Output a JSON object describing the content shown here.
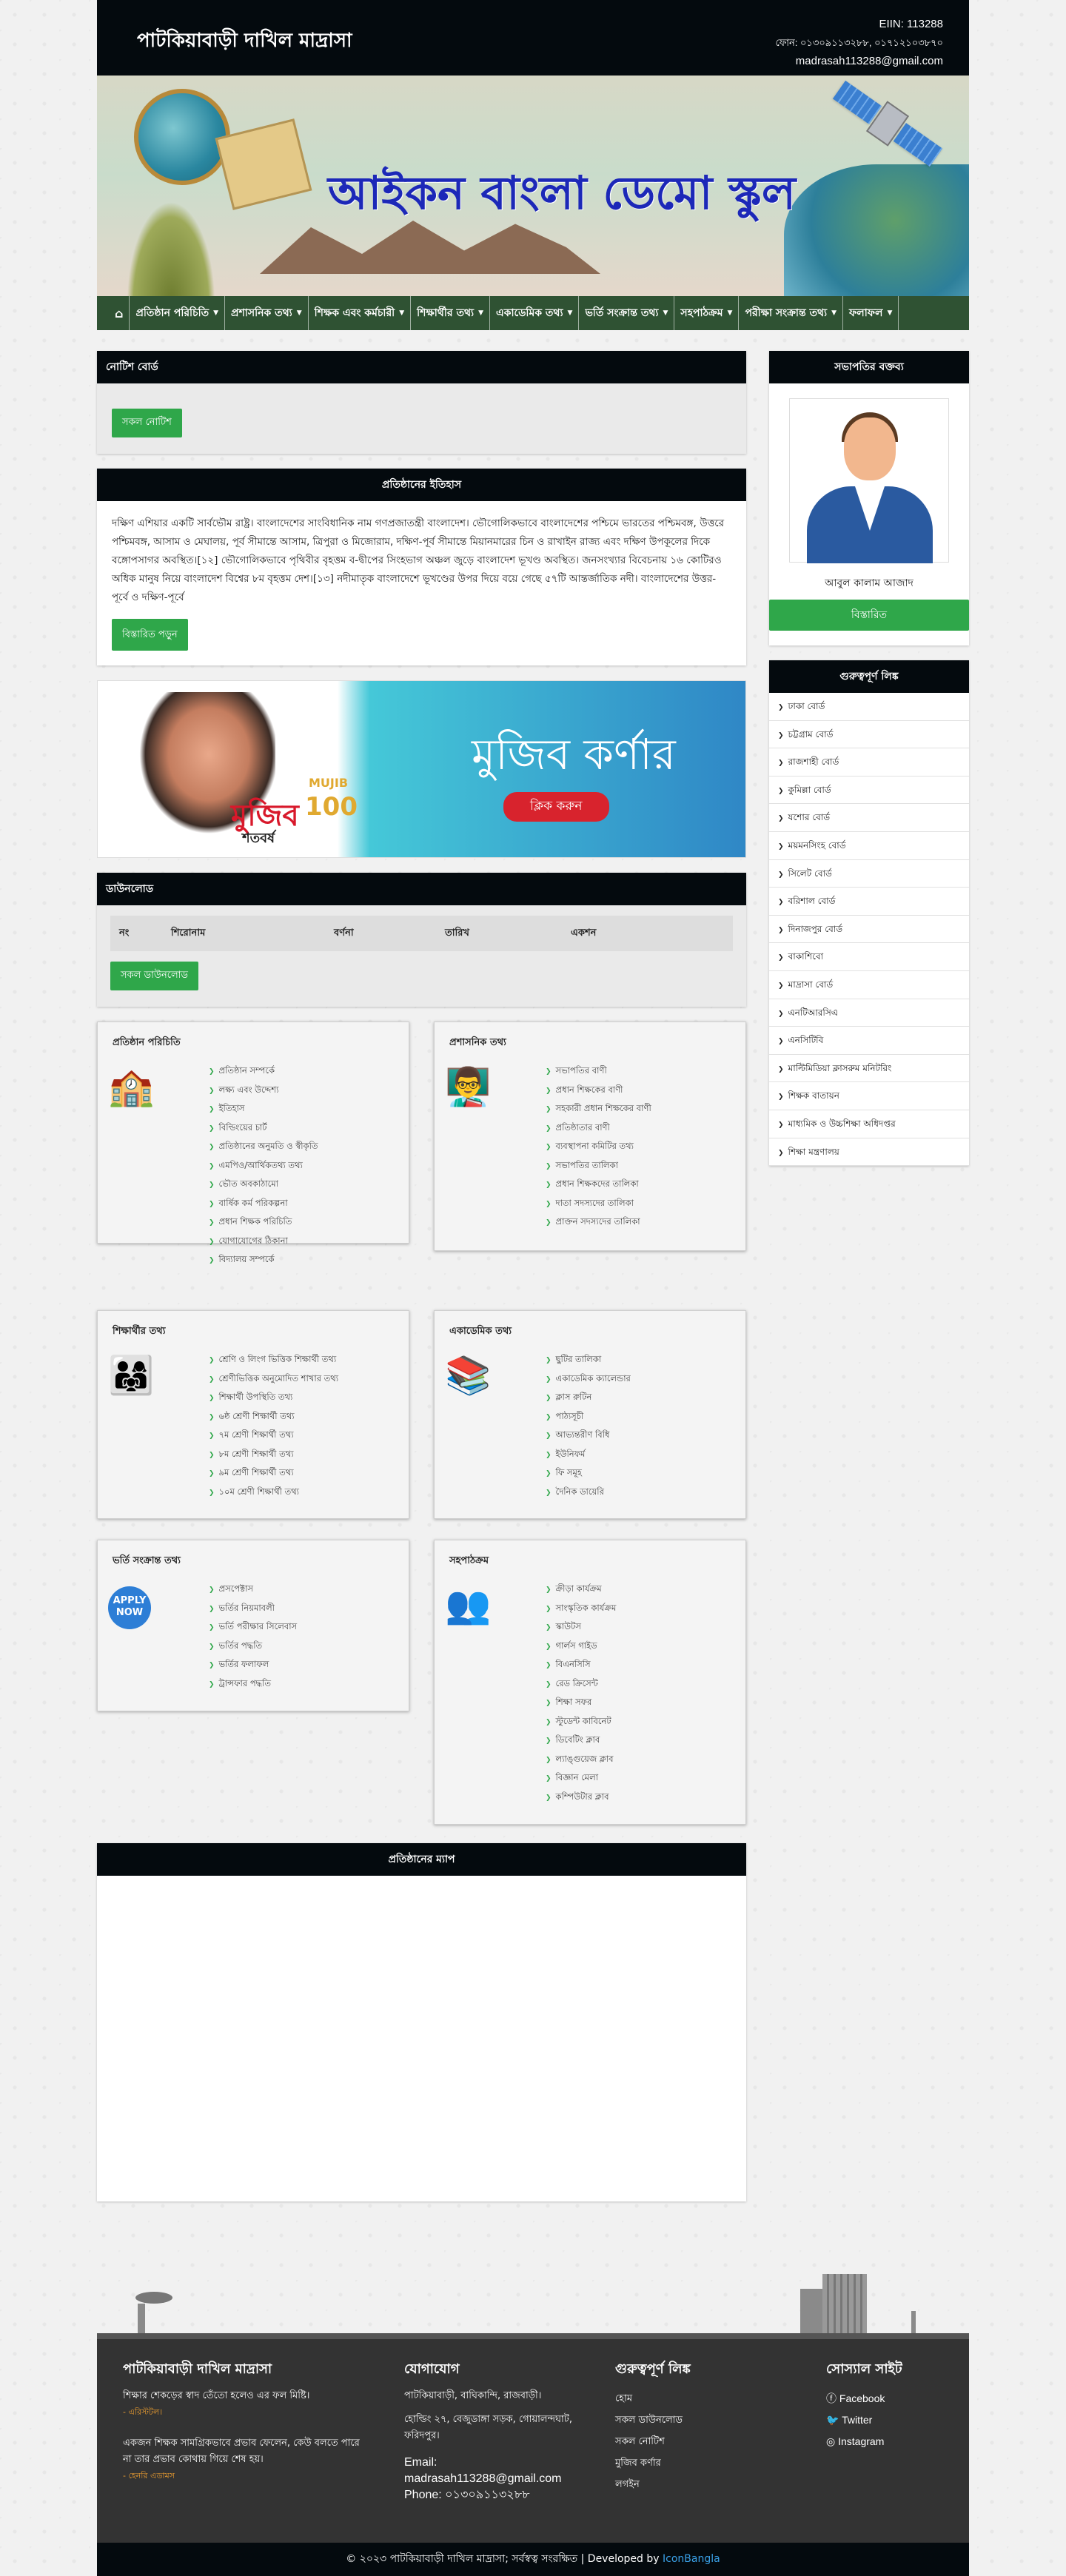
{
  "header": {
    "school_name": "পাটকিয়াবাড়ী দাখিল মাদ্রাসা",
    "eiin": "EIIN: 113288",
    "phone": "ফোন: ০১৩০৯১১৩২৮৮, ০১৭১২১০৩৮৭০",
    "email": "madrasah113288@gmail.com"
  },
  "banner": {
    "title": "আইকন বাংলা ডেমো স্কুল"
  },
  "nav": [
    {
      "label": "প্রতিষ্ঠান পরিচিতি",
      "caret": true
    },
    {
      "label": "প্রশাসনিক তথ্য",
      "caret": true
    },
    {
      "label": "শিক্ষক এবং কর্মচারী",
      "caret": true
    },
    {
      "label": "শিক্ষার্থীর তথ্য",
      "caret": true
    },
    {
      "label": "একাডেমিক তথ্য",
      "caret": true
    },
    {
      "label": "ভর্তি সংক্রান্ত তথ্য",
      "caret": true
    },
    {
      "label": "সহপাঠক্রম",
      "caret": true
    },
    {
      "label": "পরীক্ষা সংক্রান্ত তথ্য",
      "caret": true
    },
    {
      "label": "ফলাফল",
      "caret": true
    }
  ],
  "notice": {
    "heading": "নোটিশ বোর্ড",
    "all_button": "সকল নোটিশ"
  },
  "history": {
    "heading": "প্রতিষ্ঠানের ইতিহাস",
    "text": "দক্ষিণ এশিয়ার একটি সার্বভৌম রাষ্ট্র। বাংলাদেশের সাংবিধানিক নাম গণপ্রজাতন্ত্রী বাংলাদেশ। ভৌগোলিকভাবে বাংলাদেশের পশ্চিমে ভারতের পশ্চিমবঙ্গ, উত্তরে পশ্চিমবঙ্গ, আসাম ও মেঘালয়, পূর্ব সীমান্তে আসাম, ত্রিপুরা ও মিজোরাম, দক্ষিণ-পূর্ব সীমান্তে মিয়ানমারের চিন ও রাখাইন রাজ্য এবং দক্ষিণ উপকূলের দিকে বঙ্গোপসাগর অবস্থিত।[১২] ভৌগোলিকভাবে পৃথিবীর বৃহত্তম ব-দ্বীপের সিংহভাগ অঞ্চল জুড়ে বাংলাদেশ ভূখণ্ড অবস্থিত। জনসংখ্যার বিবেচনায় ১৬ কোটিরও অধিক মানুষ নিয়ে বাংলাদেশ বিশ্বের ৮ম বৃহত্তম দেশ।[১৩] নদীমাতৃক বাংলাদেশে ভূখণ্ডের উপর দিয়ে বয়ে গেছে ৫৭টি আন্তর্জাতিক নদী। বাংলাদেশের উত্তর-পূর্বে ও দক্ষিণ-পূর্বে",
    "button": "বিস্তারিত পড়ুন"
  },
  "mujib": {
    "title": "মুজিব কর্ণার",
    "click": "ক্লিক করুন",
    "brand": "মুজিব",
    "brand_sub": "শতবর্ষ",
    "brand_en": "MUJIB",
    "brand_100": "100"
  },
  "download": {
    "heading": "ডাউনলোড",
    "cols": [
      "নং",
      "শিরোনাম",
      "বর্ণনা",
      "তারিখ",
      "একশন"
    ],
    "button": "সকল ডাউনলোড"
  },
  "boxes": [
    {
      "title": "প্রতিষ্ঠান পরিচিতি",
      "icon": "school-icon",
      "items": [
        "প্রতিষ্ঠান সম্পর্কে",
        "লক্ষ্য এবং উদ্দেশ্য",
        "ইতিহাস",
        "বিল্ডিংয়ের চার্ট",
        "প্রতিষ্ঠানের অনুমতি ও স্বীকৃতি",
        "এমপিও/আর্থিকতথ্য তথ্য",
        "ভৌত অবকাঠামো",
        "বার্ষিক কর্ম পরিকল্পনা",
        "প্রধান শিক্ষক পরিচিতি",
        "যোগাযোগের ঠিকানা",
        "বিদ্যালয় সম্পর্কে"
      ]
    },
    {
      "title": "প্রশাসনিক তথ্য",
      "icon": "admin-icon",
      "items": [
        "সভাপতির বাণী",
        "প্রধান শিক্ষকের বাণী",
        "সহকারী প্রধান শিক্ষকের বাণী",
        "প্রতিষ্ঠাতার বাণী",
        "ব্যবস্থাপনা কমিটির তথ্য",
        "সভাপতির তালিকা",
        "প্রধান শিক্ষকদের তালিকা",
        "দাতা সদস্যদের তালিকা",
        "প্রাক্তন সদস্যদের তালিকা"
      ]
    },
    {
      "title": "শিক্ষার্থীর তথ্য",
      "icon": "students-icon",
      "items": [
        "শ্রেণি ও লিংগ ভিত্তিক শিক্ষার্থী তথ্য",
        "শ্রেণীভিত্তিক অনুমোদিত শাখার তথ্য",
        "শিক্ষার্থী উপস্থিতি তথ্য",
        "৬ষ্ঠ শ্রেণী শিক্ষার্থী তথ্য",
        "৭ম শ্রেণী শিক্ষার্থী তথ্য",
        "৮ম শ্রেণী শিক্ষার্থী তথ্য",
        "৯ম শ্রেণী শিক্ষার্থী তথ্য",
        "১০ম শ্রেণী শিক্ষার্থী তথ্য"
      ]
    },
    {
      "title": "একাডেমিক তথ্য",
      "icon": "books-icon",
      "items": [
        "ছুটির তালিকা",
        "একাডেমিক ক্যালেন্ডার",
        "ক্লাস রুটিন",
        "পাঠ্যসূচী",
        "আভ্যন্তরীণ বিধি",
        "ইউনিফর্ম",
        "ফি সমূহ",
        "দৈনিক ডায়েরি"
      ]
    },
    {
      "title": "ভর্তি সংক্রান্ত তথ্য",
      "icon": "apply-now-icon",
      "items": [
        "প্রসপেক্টাস",
        "ভর্তির নিয়মাবলী",
        "ভর্তি পরীক্ষার সিলেবাস",
        "ভর্তির পদ্ধতি",
        "ভর্তির ফলাফল",
        "ট্রান্সফার পদ্ধতি"
      ]
    },
    {
      "title": "সহপাঠক্রম",
      "icon": "cocurricular-icon",
      "items": [
        "ক্রীড়া কার্যক্রম",
        "সাংস্কৃতিক কার্যক্রম",
        "স্কাউটস",
        "গার্লস গাইড",
        "বিএনসিসি",
        "রেড ক্রিসেন্ট",
        "শিক্ষা সফর",
        "স্টুডেন্ট কাবিনেট",
        "ডিবেটিং ক্লাব",
        "ল্যাঙ্গুয়েজ ক্লাব",
        "বিজ্ঞান মেলা",
        "কম্পিউটার ক্লাব"
      ]
    }
  ],
  "map": {
    "heading": "প্রতিষ্ঠানের ম্যাপ"
  },
  "chairman": {
    "heading": "সভাপতির বক্তব্য",
    "name": "আবুল কালাম আজাদ",
    "button": "বিস্তারিত"
  },
  "links": {
    "heading": "গুরুত্বপূর্ণ লিঙ্ক",
    "items": [
      "ঢাকা বোর্ড",
      "চট্টগ্রাম বোর্ড",
      "রাজশাহী বোর্ড",
      "কুমিল্লা বোর্ড",
      "যশোর বোর্ড",
      "ময়মনসিংহ বোর্ড",
      "সিলেট বোর্ড",
      "বরিশাল বোর্ড",
      "দিনাজপুর বোর্ড",
      "বাকাশিবো",
      "মাদ্রাসা বোর্ড",
      "এনটিআরসিএ",
      "এনসিটিবি",
      "মাল্টিমিডিয়া ক্লাসরুম মনিটরিং",
      "শিক্ষক বাতায়ন",
      "মাধ্যমিক ও উচ্চশিক্ষা অধিদপ্তর",
      "শিক্ষা মন্ত্রণালয়"
    ]
  },
  "footer": {
    "about_title": "পাটকিয়াবাড়ী দাখিল মাদ্রাসা",
    "quote1": "শিক্ষার শেকড়ের স্বাদ তেঁতো হলেও এর ফল মিষ্টি।",
    "author1": "- এরিস্টটল।",
    "quote2": "একজন শিক্ষক সামগ্রিকভাবে প্রভাব ফেলেন, কেউ বলতে পারে না তার প্রভাব কোথায় গিয়ে শেষ হয়।",
    "author2": "- হেনরি এডামস",
    "contact_title": "যোগাযোগ",
    "address1": "পাটকিয়াবাড়ী, বাঘিকান্দি, রাজবাড়ী।",
    "address2": "হোল্ডিং ২৭, বেজুডাঙ্গা সড়ক, গোয়ালন্দঘাট, ফরিদপুর।",
    "email_label": "Email:",
    "email": "madrasah113288@gmail.com",
    "phone": "Phone: ০১৩০৯১১৩২৮৮",
    "links_title": "গুরুত্বপূর্ণ লিঙ্ক",
    "links": [
      "হোম",
      "সকল ডাউনলোড",
      "সকল নোটিশ",
      "মুজিব কর্ণার",
      "লগইন"
    ],
    "social_title": "সোস্যাল সাইট",
    "social": [
      "Facebook",
      "Twitter",
      "Instagram"
    ],
    "copyright": "© ২০২৩ পাটকিয়াবাড়ী দাখিল মাদ্রাসা; সর্বস্বত্ব সংরক্ষিত | Developed by",
    "dev": "IconBangla"
  }
}
